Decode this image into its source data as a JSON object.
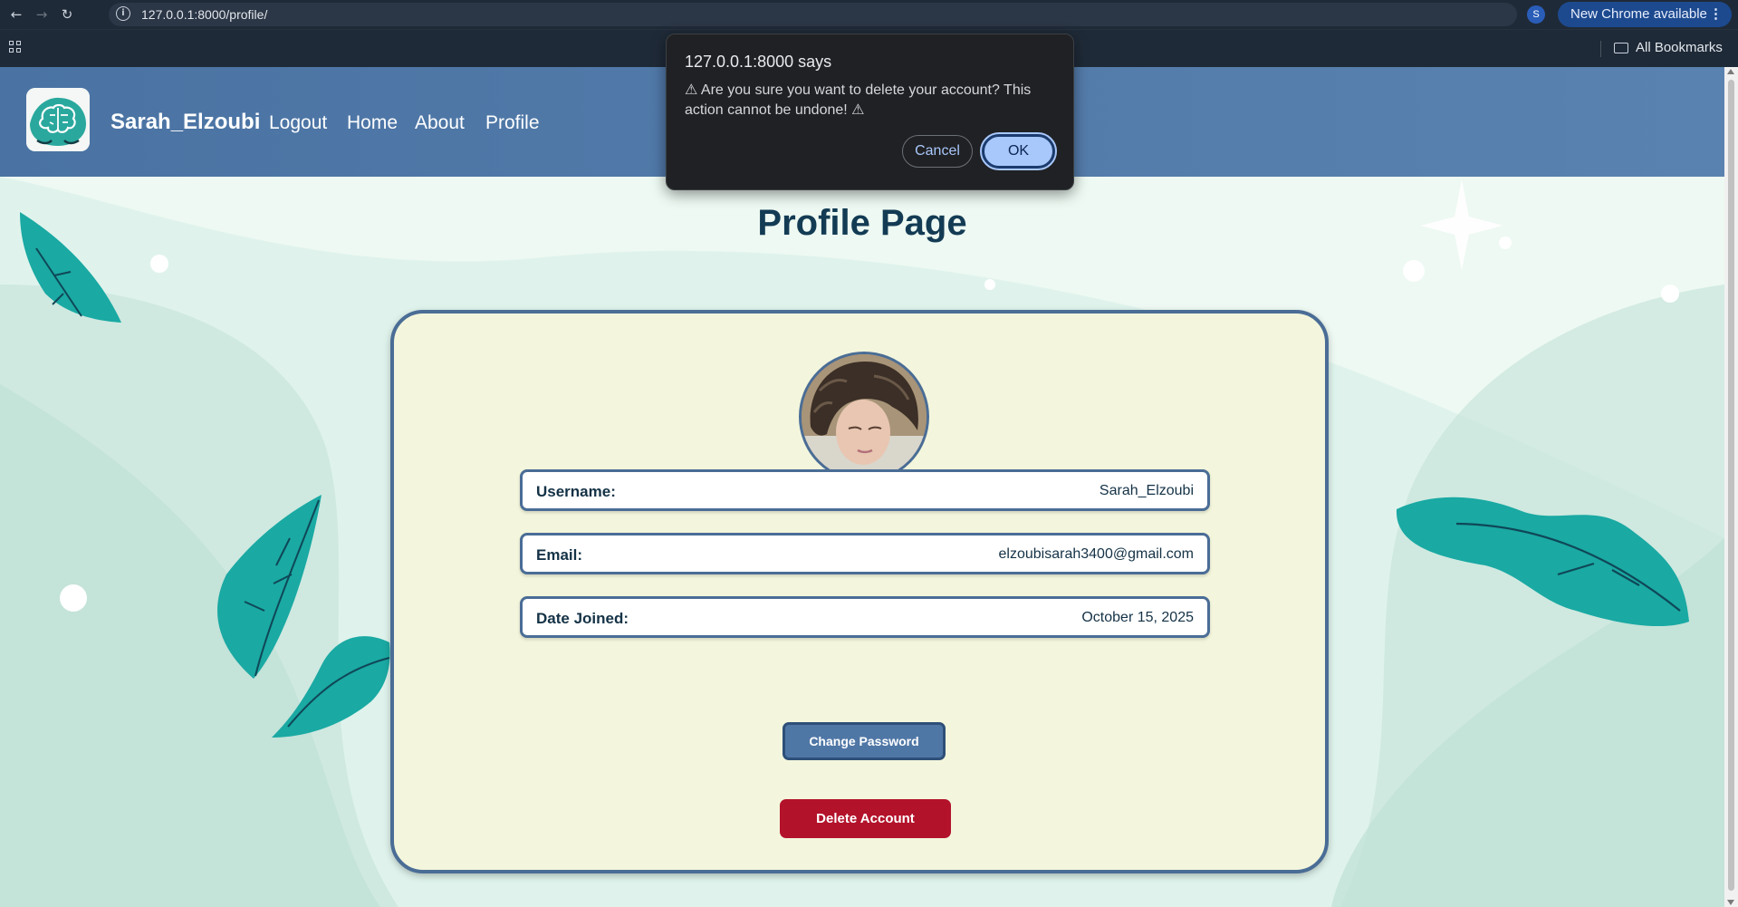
{
  "browser": {
    "url": "127.0.0.1:8000/profile/",
    "update_label": "New Chrome available",
    "bookmarks_label": "All Bookmarks",
    "profile_initial": "S"
  },
  "header": {
    "brand": "Sarah_Elzoubi",
    "nav": [
      "Logout",
      "Home",
      "About",
      "Profile"
    ]
  },
  "page": {
    "title": "Profile Page",
    "fields": [
      {
        "label": "Username:",
        "value": "Sarah_Elzoubi"
      },
      {
        "label": "Email:",
        "value": "elzoubisarah3400@gmail.com"
      },
      {
        "label": "Date Joined:",
        "value": "October 15, 2025"
      }
    ],
    "change_password_label": "Change Password",
    "delete_account_label": "Delete Account"
  },
  "dialog": {
    "title": "127.0.0.1:8000 says",
    "message": "⚠ Are you sure you want to delete your account? This action cannot be undone! ⚠",
    "cancel_label": "Cancel",
    "ok_label": "OK"
  },
  "colors": {
    "header": "#4f77a6",
    "card_bg": "#f3f6dc",
    "card_border": "#4a6d96",
    "delete": "#b3122b",
    "leaf": "#1aa9a3",
    "title": "#133b54"
  },
  "icons": [
    "back-arrow-icon",
    "forward-arrow-icon",
    "reload-icon",
    "site-info-icon",
    "bookmark-star-icon",
    "apps-grid-icon",
    "folder-icon",
    "menu-dots-icon",
    "brain-logo-icon"
  ]
}
